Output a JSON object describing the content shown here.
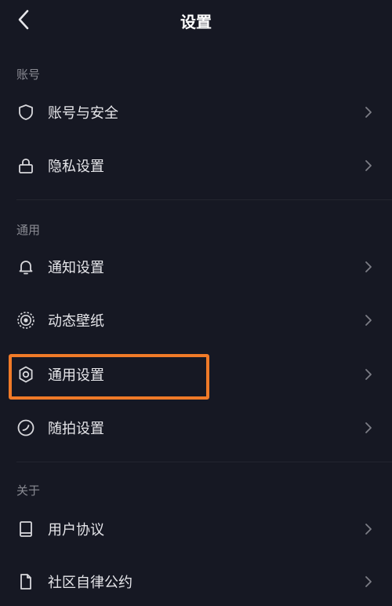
{
  "header": {
    "title": "设置",
    "back_icon": "back-arrow-icon"
  },
  "sections": [
    {
      "label": "账号",
      "items": [
        {
          "label": "账号与安全",
          "icon": "shield-icon"
        },
        {
          "label": "隐私设置",
          "icon": "lock-icon"
        }
      ]
    },
    {
      "label": "通用",
      "items": [
        {
          "label": "通知设置",
          "icon": "bell-icon"
        },
        {
          "label": "动态壁纸",
          "icon": "wallpaper-icon"
        },
        {
          "label": "通用设置",
          "icon": "gear-icon"
        },
        {
          "label": "随拍设置",
          "icon": "shoot-icon"
        }
      ]
    },
    {
      "label": "关于",
      "items": [
        {
          "label": "用户协议",
          "icon": "book-icon"
        },
        {
          "label": "社区自律公约",
          "icon": "document-icon"
        }
      ]
    }
  ],
  "highlight": {
    "item": "通用设置",
    "color": "#f07a28"
  },
  "colors": {
    "background": "#161823",
    "text": "#e6e6ea",
    "muted": "#8a8b93"
  }
}
